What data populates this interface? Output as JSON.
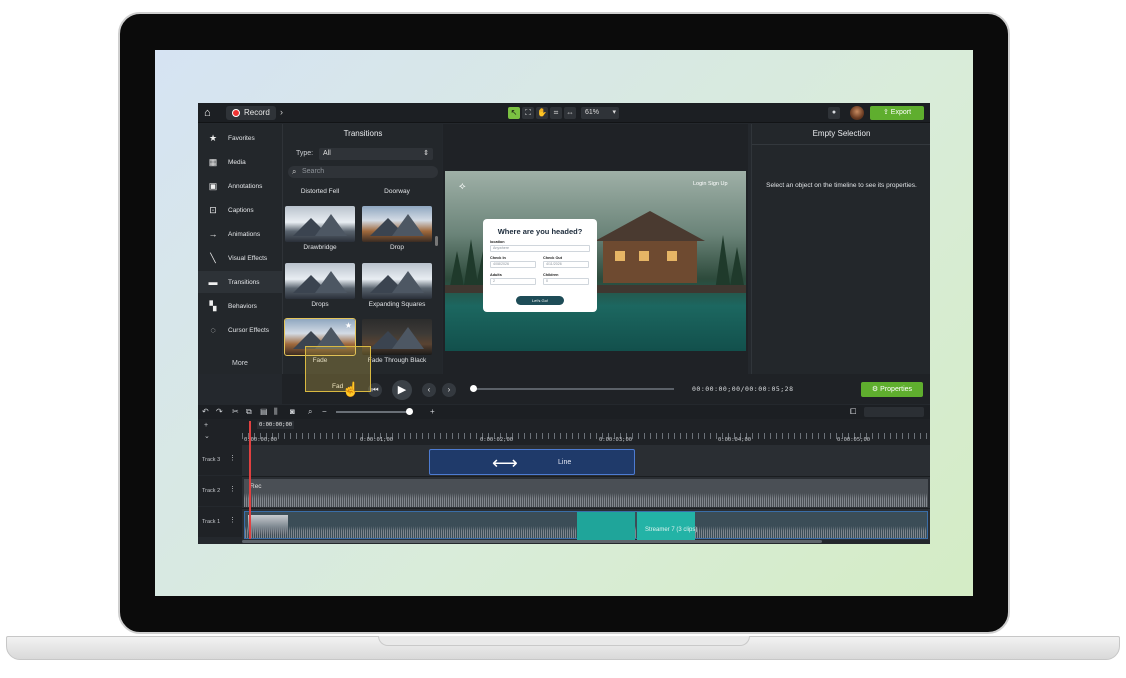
{
  "topbar": {
    "record_label": "Record",
    "zoom_value": "61%",
    "export_label": "Export"
  },
  "sidebar": {
    "items": [
      {
        "label": "Favorites",
        "icon": "star-icon"
      },
      {
        "label": "Media",
        "icon": "film-icon"
      },
      {
        "label": "Annotations",
        "icon": "annotation-icon"
      },
      {
        "label": "Captions",
        "icon": "captions-icon"
      },
      {
        "label": "Animations",
        "icon": "animation-icon"
      },
      {
        "label": "Visual Effects",
        "icon": "wand-icon"
      },
      {
        "label": "Transitions",
        "icon": "transition-icon"
      },
      {
        "label": "Behaviors",
        "icon": "behaviors-icon"
      },
      {
        "label": "Cursor Effects",
        "icon": "cursor-icon"
      }
    ],
    "more_label": "More",
    "active_index": 6
  },
  "transitions": {
    "title": "Transitions",
    "type_label": "Type:",
    "type_value": "All",
    "search_placeholder": "Search",
    "items": [
      {
        "label": "Distorted Fell"
      },
      {
        "label": "Doorway"
      },
      {
        "label": "Drawbridge"
      },
      {
        "label": "Drop"
      },
      {
        "label": "Drops"
      },
      {
        "label": "Expanding Squares"
      },
      {
        "label": "Fade"
      },
      {
        "label": "Fade Through Black"
      }
    ],
    "drag_label": "Fad"
  },
  "preview": {
    "links": "Login  Sign Up",
    "modal_title": "Where are you headed?",
    "fields": [
      {
        "label": "location",
        "value": "Anywhere"
      },
      {
        "label": "Check In",
        "value": "4/08/2026"
      },
      {
        "label": "Check Out",
        "value": "4/11/2026"
      },
      {
        "label": "Adults",
        "value": "2"
      },
      {
        "label": "Children",
        "value": "0"
      }
    ],
    "button_label": "Let's Go!"
  },
  "properties_panel": {
    "title": "Empty Selection",
    "message": "Select an object on the timeline to see its properties."
  },
  "playback": {
    "timecode": "00:00:00;00/00:00:05;28",
    "properties_button": "Properties"
  },
  "timeline": {
    "playhead_time": "0:00:00;00",
    "ruler": [
      "0:00:00;00",
      "0:00:01;00",
      "0:00:02;00",
      "0:00:03;00",
      "0:00:04;00",
      "0:00:05;00"
    ],
    "tracks": [
      {
        "name": "Track 3",
        "clip": "Line"
      },
      {
        "name": "Track 2",
        "clip": "Rec"
      },
      {
        "name": "Track 1",
        "clip": "Streamer 7   (3 clips)"
      }
    ]
  },
  "colors": {
    "accent_green": "#5fae2e",
    "panel_bg": "#24282d",
    "teal_clip": "#1fa59a",
    "line_clip": "#4d7bd1"
  }
}
